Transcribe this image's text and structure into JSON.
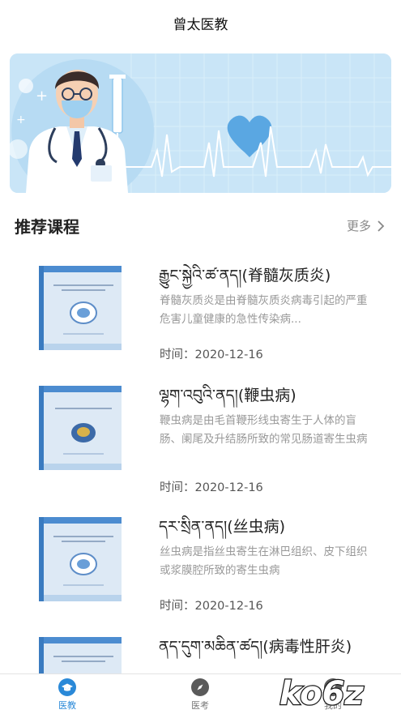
{
  "app": {
    "title": "曾太医教"
  },
  "section": {
    "title": "推荐课程",
    "more_label": "更多"
  },
  "courses": [
    {
      "title": "རྒྱུང་སྐྱེའི་ཚ་ནད།(脊髓灰质炎)",
      "desc": "脊髓灰质炎是由脊髓灰质炎病毒引起的严重危害儿童健康的急性传染病...",
      "time": "时间：2020-12-16"
    },
    {
      "title": "ལྷག་འབུའི་ནད།(鞭虫病)",
      "desc": "鞭虫病是由毛首鞭形线虫寄生于人体的盲肠、阑尾及升结肠所致的常见肠道寄生虫病",
      "time": "时间：2020-12-16"
    },
    {
      "title": "དར་སྲིན་ནད།(丝虫病)",
      "desc": "丝虫病是指丝虫寄生在淋巴组织、皮下组织或浆膜腔所致的寄生虫病",
      "time": "时间：2020-12-16"
    },
    {
      "title": "ནད་དུག་མཆིན་ཚད།(病毒性肝炎)",
      "desc": "",
      "time": ""
    }
  ],
  "tabs": [
    {
      "label": "医教",
      "icon": "graduation-cap-icon",
      "active": true
    },
    {
      "label": "医考",
      "icon": "compass-icon",
      "active": false
    },
    {
      "label": "我的",
      "icon": "person-icon",
      "active": false
    }
  ],
  "watermark": {
    "text": "ko6z"
  },
  "colors": {
    "accent": "#2a89d8",
    "banner_bg": "#c6e3f6",
    "muted_text": "#999999"
  }
}
